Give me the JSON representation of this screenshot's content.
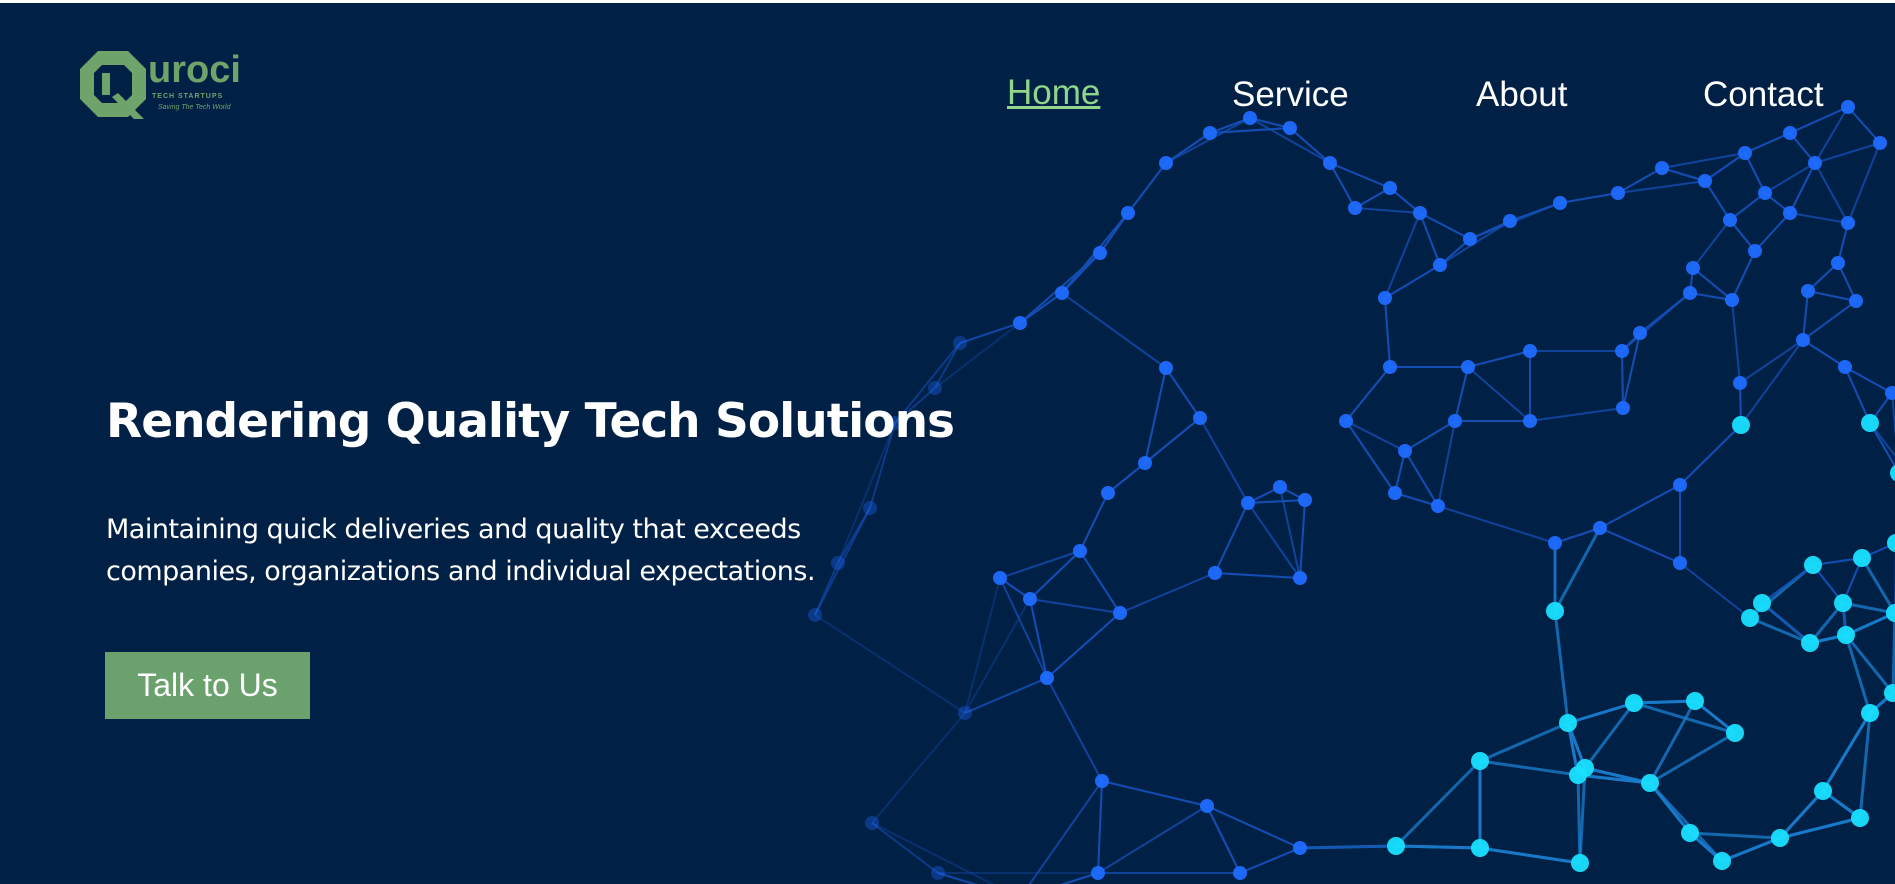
{
  "logo": {
    "word": "uroci",
    "subtitle": "TECH STARTUPS",
    "tagline": "Saving The Tech World"
  },
  "nav": [
    {
      "label": "Home",
      "active": true
    },
    {
      "label": "Service",
      "active": false
    },
    {
      "label": "About",
      "active": false
    },
    {
      "label": "Contact",
      "active": false
    }
  ],
  "hero": {
    "title": "Rendering Quality Tech Solutions",
    "subtitle_line1": "Maintaining quick deliveries and quality that exceeds",
    "subtitle_line2": "companies, organizations and individual expectations.",
    "cta_label": "Talk to Us"
  },
  "colors": {
    "background": "#002046",
    "accent": "#6aa16c",
    "active_link": "#8fd68a",
    "node": "#1f6bff",
    "node_bright": "#19e0ff"
  },
  "icons": [
    "logo-q-icon",
    "network-globe-graphic"
  ]
}
